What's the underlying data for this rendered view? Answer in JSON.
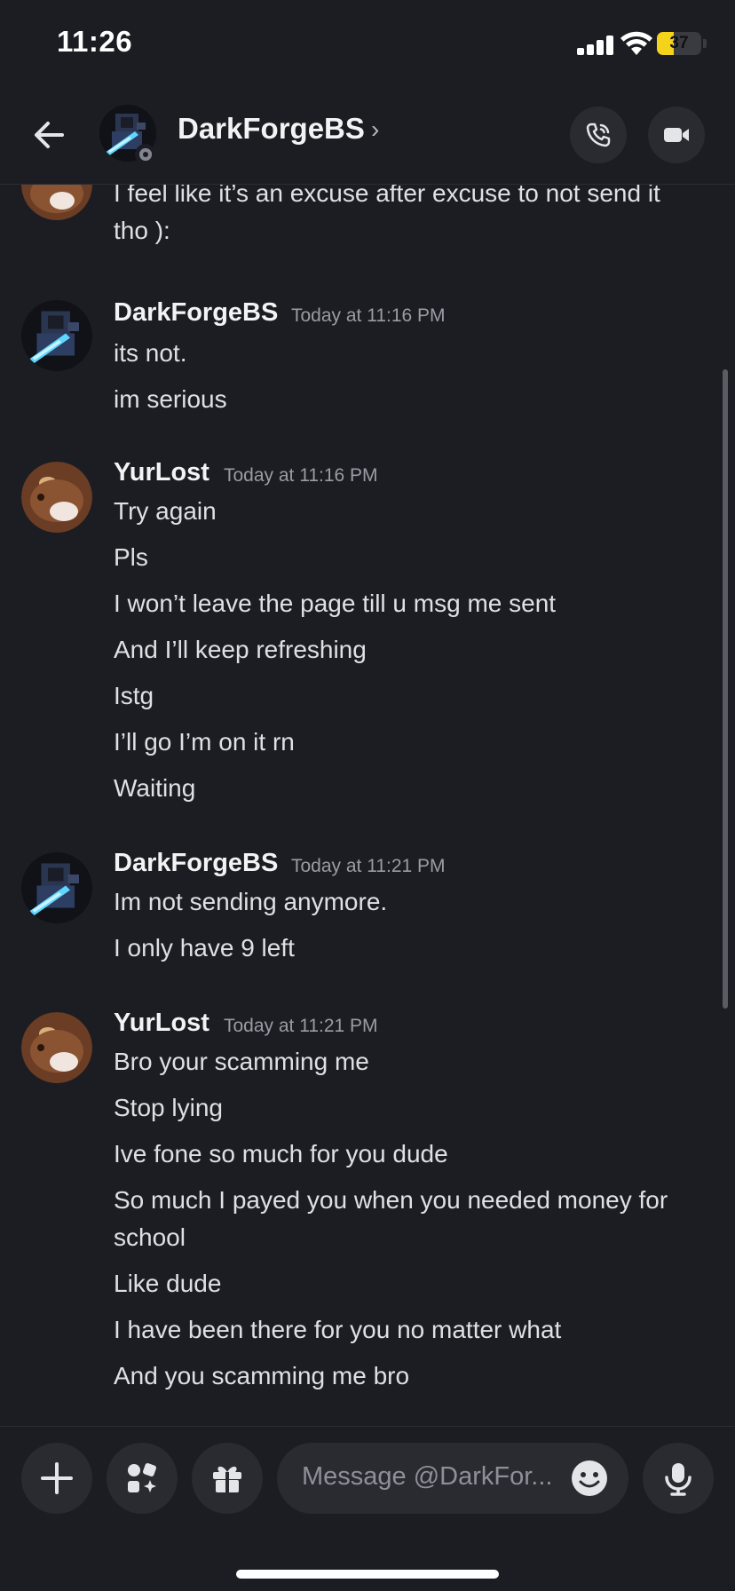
{
  "status_bar": {
    "time": "11:26",
    "battery": "37",
    "battery_level": 0.37
  },
  "header": {
    "contact_name": "DarkForgeBS",
    "chevron": "›"
  },
  "messages": {
    "partial": [
      "I feel like it’s an excuse after excuse to not send it",
      "tho ):"
    ],
    "groups": [
      {
        "author": "DarkForgeBS",
        "timestamp": "Today at 11:16 PM",
        "lines": [
          "its not.",
          "im serious"
        ]
      },
      {
        "author": "YurLost",
        "timestamp": "Today at 11:16 PM",
        "lines": [
          "Try again",
          "Pls",
          "I won’t leave the page till u msg me sent",
          "And I’ll keep refreshing",
          "Istg",
          "I’ll go I’m on it rn",
          "Waiting"
        ]
      },
      {
        "author": "DarkForgeBS",
        "timestamp": "Today at 11:21 PM",
        "lines": [
          "Im not sending anymore.",
          "I only have 9 left"
        ]
      },
      {
        "author": "YurLost",
        "timestamp": "Today at 11:21 PM",
        "lines": [
          "Bro your scamming me",
          "Stop lying",
          "Ive fone so much for you dude",
          "So much I payed you when you needed money for",
          "school",
          "Like dude",
          "I have been there for you no matter what",
          "And you scamming me bro"
        ]
      }
    ]
  },
  "composer": {
    "placeholder": "Message @DarkFor..."
  },
  "icons": {
    "back": "arrow-left-icon",
    "call": "phone-icon",
    "video": "video-camera-icon",
    "add": "plus-icon",
    "apps": "apps-icon",
    "gift": "gift-icon",
    "emoji": "emoji-icon",
    "mic": "microphone-icon"
  },
  "colors": {
    "background": "#1c1d22",
    "button": "#2a2b31",
    "battery": "#f5d31a"
  }
}
